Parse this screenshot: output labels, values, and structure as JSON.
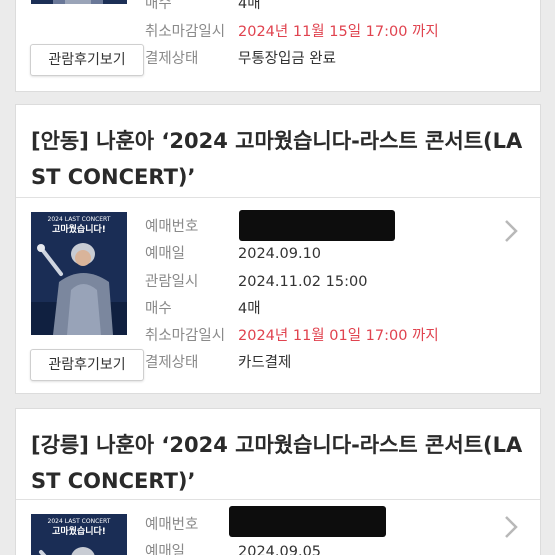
{
  "cards": [
    {
      "title": "",
      "rows": [
        {
          "label": "매수",
          "value": "4매"
        },
        {
          "label": "취소마감일시",
          "value": "2024년 11월 15일 17:00 까지"
        },
        {
          "label": "결제상태",
          "value": "무통장입금 완료"
        }
      ],
      "review_button": "관람후기보기"
    },
    {
      "title": "[안동] 나훈아 ‘2024 고마웠습니다-라스트 콘서트(LAST CONCERT)’",
      "rows": [
        {
          "label": "예매번호",
          "value": ""
        },
        {
          "label": "예매일",
          "value": "2024.09.10"
        },
        {
          "label": "관람일시",
          "value": "2024.11.02 15:00"
        },
        {
          "label": "매수",
          "value": "4매"
        },
        {
          "label": "취소마감일시",
          "value": "2024년 11월 01일 17:00 까지"
        },
        {
          "label": "결제상태",
          "value": "카드결제"
        }
      ],
      "review_button": "관람후기보기",
      "poster_text": "2024 LAST CONCERT 고마웠습니다!"
    },
    {
      "title": "[강릉] 나훈아 ‘2024 고마웠습니다-라스트 콘서트(LAST CONCERT)’",
      "rows": [
        {
          "label": "예매번호",
          "value": ""
        },
        {
          "label": "예매일",
          "value": "2024.09.05"
        }
      ],
      "poster_text": "2024 LAST CONCERT 고마웠습니다!"
    }
  ],
  "colors": {
    "deadline_red": "#e0434f",
    "label_gray": "#8a8a8a"
  },
  "icons": {
    "chevron": "chevron-right-icon"
  }
}
